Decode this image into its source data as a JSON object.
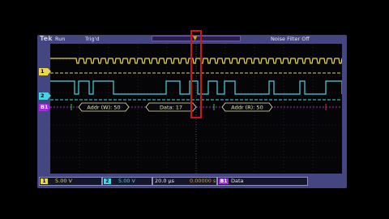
{
  "header": {
    "brand": "Tek",
    "run_state": "Run",
    "trigger_state": "Trig'd",
    "noise_filter": "Noise Filter Off"
  },
  "channels": [
    {
      "id": "1",
      "color": "#e8d84a"
    },
    {
      "id": "2",
      "color": "#4ad2e0"
    },
    {
      "id": "B1",
      "color": "#a22cd8"
    }
  ],
  "bus": {
    "packets": [
      {
        "label": "Addr (W): 50"
      },
      {
        "label": "Data: 17"
      },
      {
        "label": "Addr (R): 50"
      }
    ]
  },
  "status": {
    "ch1_num": "1",
    "ch1_scale": "5.00 V",
    "ch2_num": "2",
    "ch2_scale": "5.00 V",
    "timebase": "20.0 µs",
    "trigger_time": "0.00000 s",
    "bus_num": "B1",
    "bus_type": "Data"
  }
}
